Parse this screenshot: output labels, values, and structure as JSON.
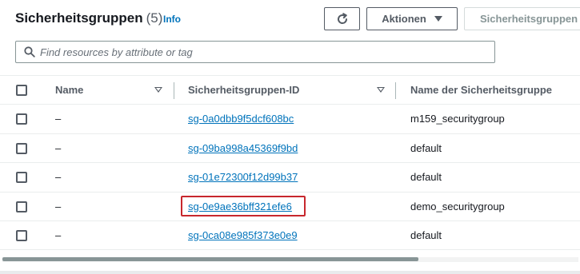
{
  "header": {
    "title": "Sicherheitsgruppen",
    "count": "(5)",
    "info": "Info",
    "actions_label": "Aktionen",
    "create_label": "Sicherheitsgruppen"
  },
  "search": {
    "placeholder": "Find resources by attribute or tag"
  },
  "table": {
    "columns": [
      "Name",
      "Sicherheitsgruppen-ID",
      "Name der Sicherheitsgruppe"
    ],
    "rows": [
      {
        "name": "–",
        "id": "sg-0a0dbb9f5dcf608bc",
        "group_name": "m159_securitygroup"
      },
      {
        "name": "–",
        "id": "sg-09ba998a45369f9bd",
        "group_name": "default"
      },
      {
        "name": "–",
        "id": "sg-01e72300f12d99b37",
        "group_name": "default"
      },
      {
        "name": "–",
        "id": "sg-0e9ae36bff321efe6",
        "group_name": "demo_securitygroup"
      },
      {
        "name": "–",
        "id": "sg-0ca08e985f373e0e9",
        "group_name": "default"
      }
    ]
  },
  "colors": {
    "link": "#0073bb",
    "highlight": "#c7272d"
  }
}
